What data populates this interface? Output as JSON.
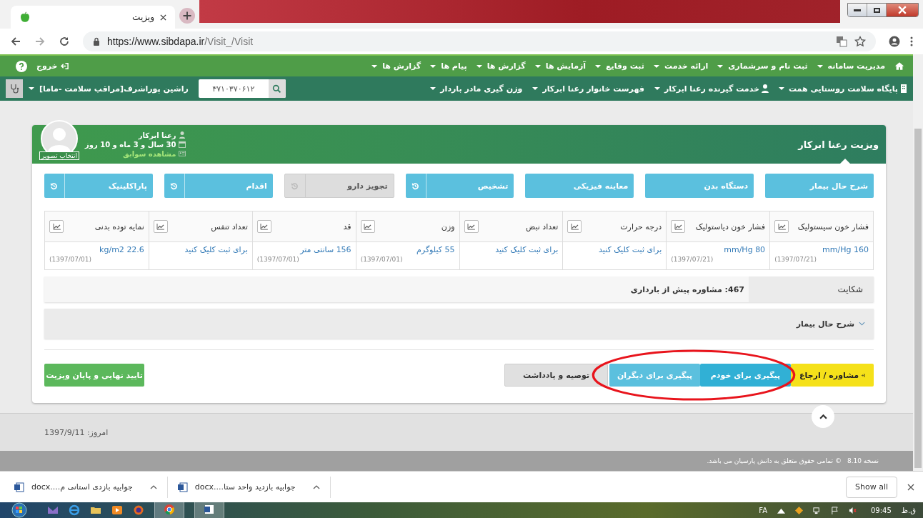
{
  "browser": {
    "tab_title": "ویزیت",
    "url_host": "https://www.sibdapa.ir",
    "url_path": "/Visit_/Visit"
  },
  "top_nav": {
    "items": [
      "مدیریت سامانه",
      "ثبت نام و سرشماری",
      "ارائه خدمت",
      "ثبت وقایع",
      "آزمایش ها",
      "گزارش ها",
      "پیام ها",
      "گزارش ها"
    ],
    "logout": "خروج"
  },
  "sub_nav": {
    "items": [
      {
        "label": "پایگاه سلامت روستایی همت",
        "kind": "facility"
      },
      {
        "label": "خدمت گیرنده رعنا ابرکار",
        "kind": "patient"
      },
      {
        "label": "فهرست خانوار رعنا ابرکار",
        "kind": "plain"
      },
      {
        "label": "وزن گیری مادر باردار",
        "kind": "plain"
      }
    ],
    "search_value": "۳۷۱۰۳۷۰۶۱۲",
    "user": "راشین پوراشرف[مراقب سلامت -ماما]"
  },
  "card": {
    "title": "ویزیت رعنا ابرکار",
    "patient_name": "رعنا ابرکار",
    "age": "30 سال و 3 ماه و 10 روز",
    "history_link": "مشاهده سوابق",
    "photo_label": "انتخاب تصویر"
  },
  "sections": [
    {
      "label": "شرح حال بیمار",
      "history_icon": false,
      "disabled": false
    },
    {
      "label": "دستگاه بدن",
      "history_icon": false,
      "disabled": false
    },
    {
      "label": "معاینه فیزیکی",
      "history_icon": false,
      "disabled": false
    },
    {
      "label": "تشخیص",
      "history_icon": true,
      "disabled": false
    },
    {
      "label": "تجویز دارو",
      "history_icon": true,
      "disabled": true
    },
    {
      "label": "اقدام",
      "history_icon": true,
      "disabled": false
    },
    {
      "label": "پاراکلینیک",
      "history_icon": true,
      "disabled": false
    }
  ],
  "vitals": [
    {
      "label": "فشار خون سیستولیک",
      "value": "160 mm/Hg",
      "date": "(1397/07/21)"
    },
    {
      "label": "فشار خون دیاستولیک",
      "value": "80 mm/Hg",
      "date": "(1397/07/21)"
    },
    {
      "label": "درجه حرارت",
      "value": "برای ثبت کلیک کنید"
    },
    {
      "label": "تعداد نبض",
      "value": "برای ثبت کلیک کنید"
    },
    {
      "label": "وزن",
      "value": "55 کیلوگرم",
      "date": "(1397/07/01)"
    },
    {
      "label": "قد",
      "value": "156 سانتی متر",
      "date": "(1397/07/01)"
    },
    {
      "label": "تعداد تنفس",
      "value": "برای ثبت کلیک کنید"
    },
    {
      "label": "نمایه توده بدنی",
      "value": "22.6 kg/m2",
      "date": "(1397/07/01)"
    }
  ],
  "complaint": {
    "label": "شکایت",
    "value": "467: مشاوره پیش از بارداری"
  },
  "history_panel": {
    "label": "شرح حال بیمار",
    "expanded": false
  },
  "actions": [
    {
      "label": "مشاوره / ارجاع",
      "kind": "referral",
      "circled": false
    },
    {
      "label": "پیگیری برای خودم",
      "kind": "follow_self",
      "circled": true
    },
    {
      "label": "پیگیری برای دیگران",
      "kind": "follow_others",
      "circled": true
    },
    {
      "label": "توصیه و یادداشت",
      "kind": "note",
      "circled": false
    },
    {
      "label": "تایید نهایی و پایان ویزیت",
      "kind": "finish",
      "circled": false
    }
  ],
  "footer": {
    "today": "امروز: 1397/9/11",
    "version": "نسخه 8.10",
    "copyright": "© تمامی حقوق متعلق به دانش پارسیان می باشد."
  },
  "downloads": {
    "items": [
      "جوابیه بازدید واحد ستا....docx",
      "جوابیه بازدی استانی م....docx"
    ],
    "show_all": "Show all"
  },
  "taskbar": {
    "language": "FA",
    "time": "09:45",
    "period": "ق.ظ"
  }
}
